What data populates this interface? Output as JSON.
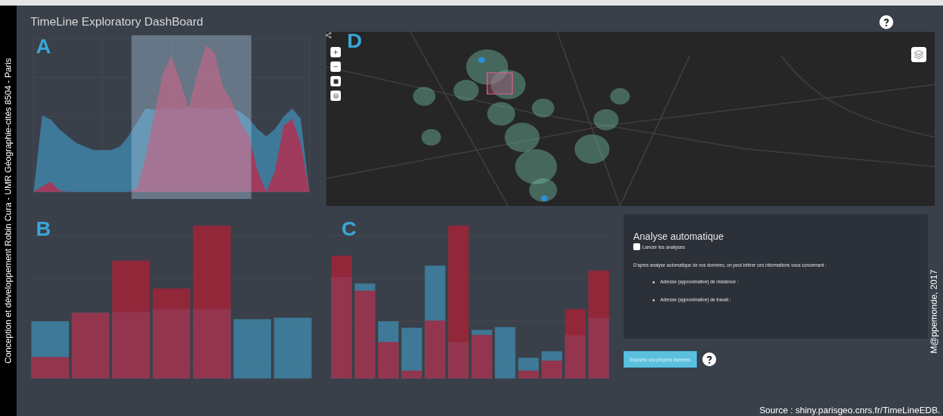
{
  "header": {
    "title": "TimeLine Exploratory DashBoard"
  },
  "credits": {
    "side": "Conception et développement Robin Cura - UMR Géographie-cités 8504 - Paris",
    "journal": "M@ppemonde, 2017",
    "source": "Source : shiny.parisgeo.cnrs.fr/TimeLineEDB."
  },
  "panels": {
    "timeline": {
      "letter": "A"
    },
    "map": {
      "letter": "D"
    },
    "weekday_chart": {
      "letter": "B"
    },
    "month_chart": {
      "letter": "C"
    }
  },
  "analysis": {
    "title": "Analyse automatique",
    "checkbox": {
      "label": "Lancer les analyses",
      "checked": false
    },
    "intro": "D'après analyse automatique de vos données, on peut inférer ces informations vous concernant :",
    "items": [
      "Adresse (approximative) de résidence :",
      "Adresse (approximative) de travail :"
    ]
  },
  "explore_button": {
    "label": "Explorez vos propres données"
  }
}
